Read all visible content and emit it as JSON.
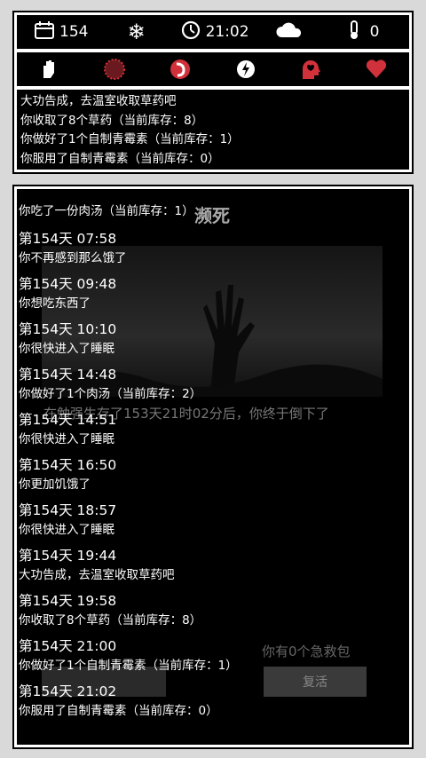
{
  "status": {
    "day": "154",
    "time": "21:02",
    "temp": "0"
  },
  "status_icons": [
    "hand-icon",
    "virus-icon",
    "stomach-icon",
    "brain-bolt-icon",
    "head-heart-icon",
    "heart-icon"
  ],
  "top_log": [
    "大功告成，去温室收取草药吧",
    "你收取了8个草药（当前库存：8）",
    "你做好了1个自制青霉素（当前库存：1）",
    "你服用了自制青霉素（当前库存：0）"
  ],
  "overlay": {
    "title": "濒死",
    "message": "在勉强生存了153天21时02分后，你终于倒下了",
    "aid_count": "你有0个急救包",
    "revive_label": "复活"
  },
  "main_log": {
    "first": "你吃了一份肉汤（当前库存：1）",
    "entries": [
      {
        "time": "第154天 07:58",
        "msg": "你不再感到那么饿了"
      },
      {
        "time": "第154天 09:48",
        "msg": "你想吃东西了"
      },
      {
        "time": "第154天 10:10",
        "msg": "你很快进入了睡眠"
      },
      {
        "time": "第154天 14:48",
        "msg": "你做好了1个肉汤（当前库存：2）"
      },
      {
        "time": "第154天 14:51",
        "msg": "你很快进入了睡眠"
      },
      {
        "time": "第154天 16:50",
        "msg": "你更加饥饿了"
      },
      {
        "time": "第154天 18:57",
        "msg": "你很快进入了睡眠"
      },
      {
        "time": "第154天 19:44",
        "msg": "大功告成，去温室收取草药吧"
      },
      {
        "time": "第154天 19:58",
        "msg": "你收取了8个草药（当前库存：8）"
      },
      {
        "time": "第154天 21:00",
        "msg": "你做好了1个自制青霉素（当前库存：1）"
      },
      {
        "time": "第154天 21:02",
        "msg": "你服用了自制青霉素（当前库存：0）"
      }
    ]
  },
  "colors": {
    "accent_red": "#d0313a",
    "border": "#ffffff",
    "background": "#000000"
  }
}
